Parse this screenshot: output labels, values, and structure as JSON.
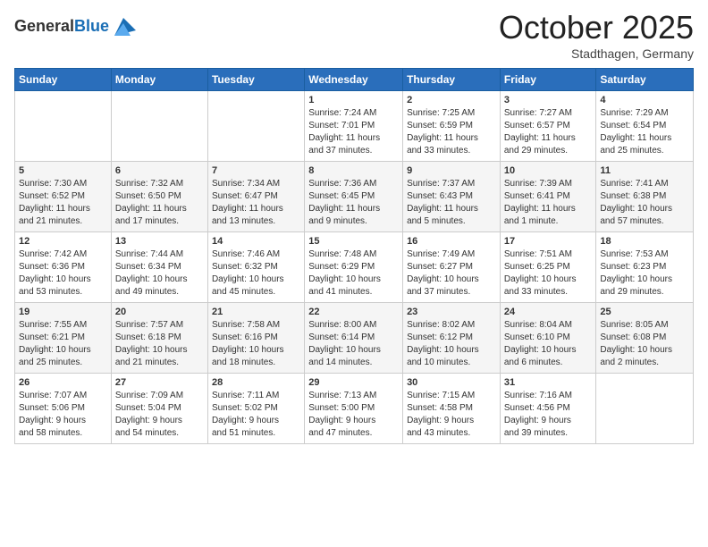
{
  "header": {
    "logo": {
      "general": "General",
      "blue": "Blue"
    },
    "title": "October 2025",
    "location": "Stadthagen, Germany"
  },
  "weekdays": [
    "Sunday",
    "Monday",
    "Tuesday",
    "Wednesday",
    "Thursday",
    "Friday",
    "Saturday"
  ],
  "weeks": [
    [
      {
        "day": "",
        "info": ""
      },
      {
        "day": "",
        "info": ""
      },
      {
        "day": "",
        "info": ""
      },
      {
        "day": "1",
        "info": "Sunrise: 7:24 AM\nSunset: 7:01 PM\nDaylight: 11 hours\nand 37 minutes."
      },
      {
        "day": "2",
        "info": "Sunrise: 7:25 AM\nSunset: 6:59 PM\nDaylight: 11 hours\nand 33 minutes."
      },
      {
        "day": "3",
        "info": "Sunrise: 7:27 AM\nSunset: 6:57 PM\nDaylight: 11 hours\nand 29 minutes."
      },
      {
        "day": "4",
        "info": "Sunrise: 7:29 AM\nSunset: 6:54 PM\nDaylight: 11 hours\nand 25 minutes."
      }
    ],
    [
      {
        "day": "5",
        "info": "Sunrise: 7:30 AM\nSunset: 6:52 PM\nDaylight: 11 hours\nand 21 minutes."
      },
      {
        "day": "6",
        "info": "Sunrise: 7:32 AM\nSunset: 6:50 PM\nDaylight: 11 hours\nand 17 minutes."
      },
      {
        "day": "7",
        "info": "Sunrise: 7:34 AM\nSunset: 6:47 PM\nDaylight: 11 hours\nand 13 minutes."
      },
      {
        "day": "8",
        "info": "Sunrise: 7:36 AM\nSunset: 6:45 PM\nDaylight: 11 hours\nand 9 minutes."
      },
      {
        "day": "9",
        "info": "Sunrise: 7:37 AM\nSunset: 6:43 PM\nDaylight: 11 hours\nand 5 minutes."
      },
      {
        "day": "10",
        "info": "Sunrise: 7:39 AM\nSunset: 6:41 PM\nDaylight: 11 hours\nand 1 minute."
      },
      {
        "day": "11",
        "info": "Sunrise: 7:41 AM\nSunset: 6:38 PM\nDaylight: 10 hours\nand 57 minutes."
      }
    ],
    [
      {
        "day": "12",
        "info": "Sunrise: 7:42 AM\nSunset: 6:36 PM\nDaylight: 10 hours\nand 53 minutes."
      },
      {
        "day": "13",
        "info": "Sunrise: 7:44 AM\nSunset: 6:34 PM\nDaylight: 10 hours\nand 49 minutes."
      },
      {
        "day": "14",
        "info": "Sunrise: 7:46 AM\nSunset: 6:32 PM\nDaylight: 10 hours\nand 45 minutes."
      },
      {
        "day": "15",
        "info": "Sunrise: 7:48 AM\nSunset: 6:29 PM\nDaylight: 10 hours\nand 41 minutes."
      },
      {
        "day": "16",
        "info": "Sunrise: 7:49 AM\nSunset: 6:27 PM\nDaylight: 10 hours\nand 37 minutes."
      },
      {
        "day": "17",
        "info": "Sunrise: 7:51 AM\nSunset: 6:25 PM\nDaylight: 10 hours\nand 33 minutes."
      },
      {
        "day": "18",
        "info": "Sunrise: 7:53 AM\nSunset: 6:23 PM\nDaylight: 10 hours\nand 29 minutes."
      }
    ],
    [
      {
        "day": "19",
        "info": "Sunrise: 7:55 AM\nSunset: 6:21 PM\nDaylight: 10 hours\nand 25 minutes."
      },
      {
        "day": "20",
        "info": "Sunrise: 7:57 AM\nSunset: 6:18 PM\nDaylight: 10 hours\nand 21 minutes."
      },
      {
        "day": "21",
        "info": "Sunrise: 7:58 AM\nSunset: 6:16 PM\nDaylight: 10 hours\nand 18 minutes."
      },
      {
        "day": "22",
        "info": "Sunrise: 8:00 AM\nSunset: 6:14 PM\nDaylight: 10 hours\nand 14 minutes."
      },
      {
        "day": "23",
        "info": "Sunrise: 8:02 AM\nSunset: 6:12 PM\nDaylight: 10 hours\nand 10 minutes."
      },
      {
        "day": "24",
        "info": "Sunrise: 8:04 AM\nSunset: 6:10 PM\nDaylight: 10 hours\nand 6 minutes."
      },
      {
        "day": "25",
        "info": "Sunrise: 8:05 AM\nSunset: 6:08 PM\nDaylight: 10 hours\nand 2 minutes."
      }
    ],
    [
      {
        "day": "26",
        "info": "Sunrise: 7:07 AM\nSunset: 5:06 PM\nDaylight: 9 hours\nand 58 minutes."
      },
      {
        "day": "27",
        "info": "Sunrise: 7:09 AM\nSunset: 5:04 PM\nDaylight: 9 hours\nand 54 minutes."
      },
      {
        "day": "28",
        "info": "Sunrise: 7:11 AM\nSunset: 5:02 PM\nDaylight: 9 hours\nand 51 minutes."
      },
      {
        "day": "29",
        "info": "Sunrise: 7:13 AM\nSunset: 5:00 PM\nDaylight: 9 hours\nand 47 minutes."
      },
      {
        "day": "30",
        "info": "Sunrise: 7:15 AM\nSunset: 4:58 PM\nDaylight: 9 hours\nand 43 minutes."
      },
      {
        "day": "31",
        "info": "Sunrise: 7:16 AM\nSunset: 4:56 PM\nDaylight: 9 hours\nand 39 minutes."
      },
      {
        "day": "",
        "info": ""
      }
    ]
  ]
}
